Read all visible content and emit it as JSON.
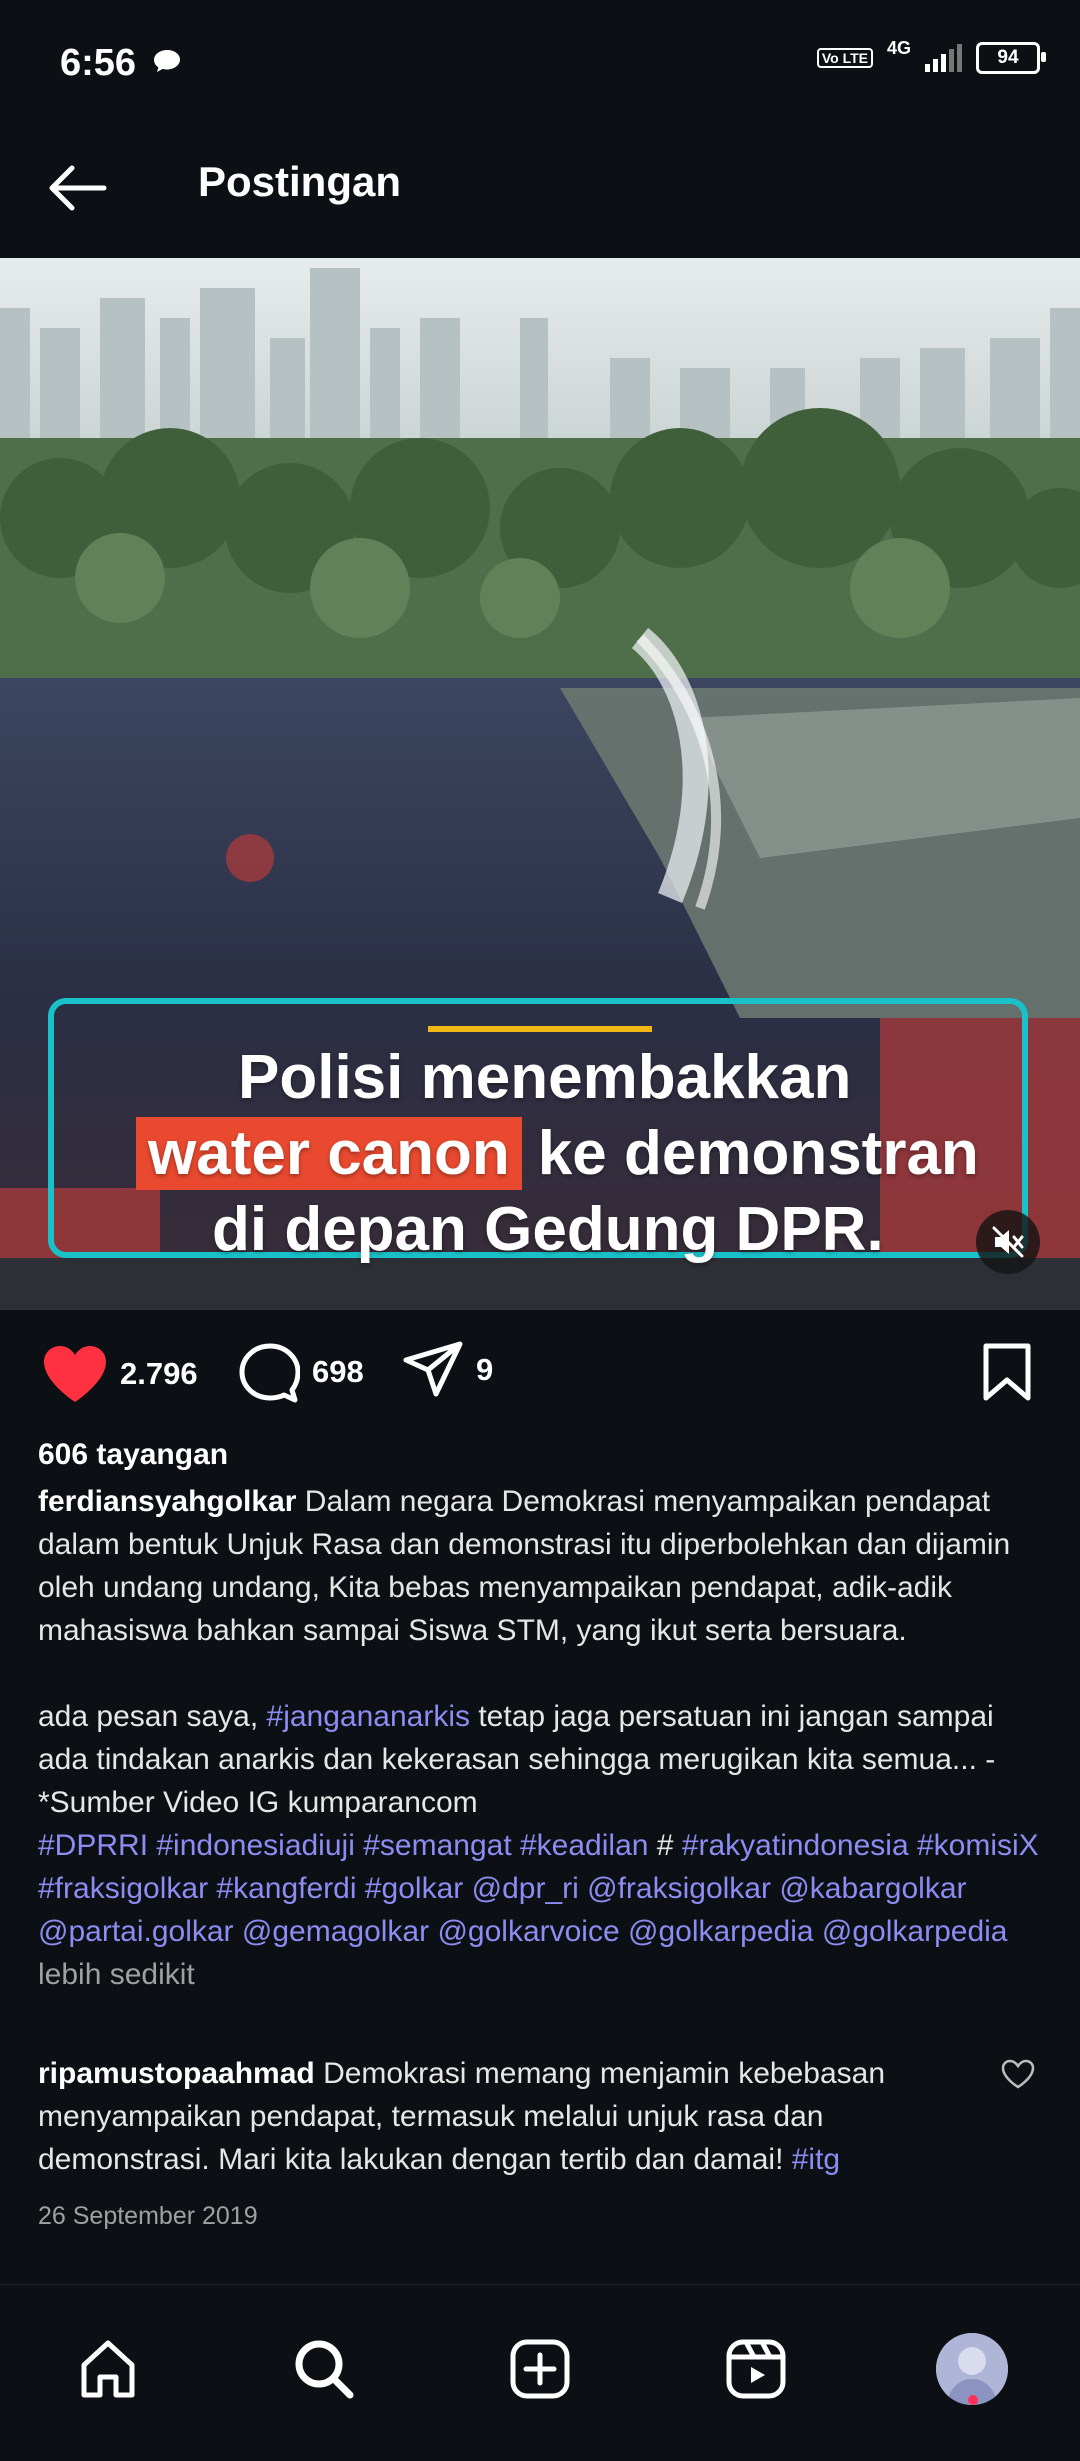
{
  "status_bar": {
    "time": "6:56",
    "volte": "Vo LTE",
    "network": "4G",
    "battery": "94"
  },
  "header": {
    "title": "Postingan",
    "back_icon": "arrow-left-icon"
  },
  "media": {
    "caption_line1": "Polisi menembakkan",
    "caption_highlight": "water canon",
    "caption_line2_rest": "ke demonstran",
    "caption_line3": "di depan Gedung DPR.",
    "accent_color": "#19c2c8",
    "highlight_color": "#e8492f",
    "mute_icon": "speaker-muted-icon"
  },
  "actions": {
    "likes": "2.796",
    "comments": "698",
    "shares": "9",
    "like_color": "#ff3040"
  },
  "post": {
    "views": "606 tayangan",
    "username": "ferdiansyahgolkar",
    "paragraph1": " Dalam negara Demokrasi menyampaikan pendapat dalam bentuk Unjuk Rasa dan demonstrasi itu diperbolehkan dan dijamin oleh undang undang, Kita bebas menyampaikan pendapat, adik-adik mahasiswa bahkan sampai Siswa STM, yang ikut serta bersuara.",
    "p2_prefix": "ada pesan saya, ",
    "p2_tag": "#jangananarkis",
    "p2_rest": " tetap jaga persatuan ini jangan sampai ada tindakan anarkis dan kekerasan sehingga merugikan kita semua... -*Sumber Video IG kumparancom",
    "tags_line": {
      "t1": "#DPRRI",
      "t2": "#indonesiadiuji",
      "t3": "#semangat",
      "t4": "#keadilan",
      "hash": "#",
      "t5": "#rakyatindonesia",
      "t6": "#komisiX",
      "t7": "#fraksigolkar",
      "t8": "#kangferdi",
      "t9": "#golkar",
      "t10": "@dpr_ri",
      "t11": "@fraksigolkar",
      "t12": "@kabargolkar",
      "t13": "@partai.golkar",
      "t14": "@gemagolkar",
      "t15": "@golkarvoice",
      "t16": "@golkarpedia",
      "t17": "@golkarpedia"
    },
    "less_label": "lebih sedikit",
    "tag_color": "#8c8cf2"
  },
  "comment": {
    "username": "ripamustopaahmad",
    "text": " Demokrasi memang menjamin kebebasan menyampaikan pendapat, termasuk melalui unjuk rasa dan demonstrasi. Mari kita lakukan dengan tertib dan damai! ",
    "tag": "#itg"
  },
  "date": "26 September 2019",
  "bottom_nav": {
    "items": [
      "home-icon",
      "search-icon",
      "create-icon",
      "reels-icon",
      "profile-avatar"
    ]
  }
}
